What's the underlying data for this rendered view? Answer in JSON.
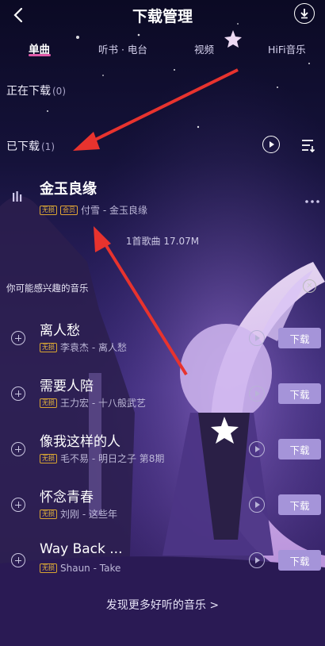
{
  "header": {
    "title": "下载管理",
    "back_icon": "chevron-left-icon",
    "download_icon": "download-circle-icon"
  },
  "tabs": [
    {
      "label": "单曲",
      "active": true
    },
    {
      "label": "听书 · 电台",
      "active": false
    },
    {
      "label": "视频",
      "active": false
    },
    {
      "label": "HiFi音乐",
      "active": false
    }
  ],
  "downloading": {
    "label": "正在下载",
    "count": "(0)"
  },
  "downloaded": {
    "label": "已下载",
    "count": "(1)"
  },
  "downloaded_song": {
    "title": "金玉良缘",
    "tag1": "无损",
    "tag2": "会员",
    "meta": "付雪 - 金玉良缘"
  },
  "summary": "1首歌曲 17.07M",
  "recommend": {
    "heading": "你可能感兴趣的音乐",
    "download_label": "下载",
    "tag": "无损",
    "items": [
      {
        "title": "离人愁",
        "meta": "李袁杰 - 离人愁"
      },
      {
        "title": "需要人陪",
        "meta": "王力宏 - 十八般武艺"
      },
      {
        "title": "像我这样的人",
        "meta": "毛不易 - 明日之子 第8期"
      },
      {
        "title": "怀念青春",
        "meta": "刘刚 - 这些年"
      },
      {
        "title": "Way Back ...",
        "meta": "Shaun - Take"
      }
    ]
  },
  "discover": "发现更多好听的音乐 >",
  "colors": {
    "accent_pink": "#e05aa8",
    "download_button": "#a594d9",
    "arrow_red": "#e8332e"
  }
}
